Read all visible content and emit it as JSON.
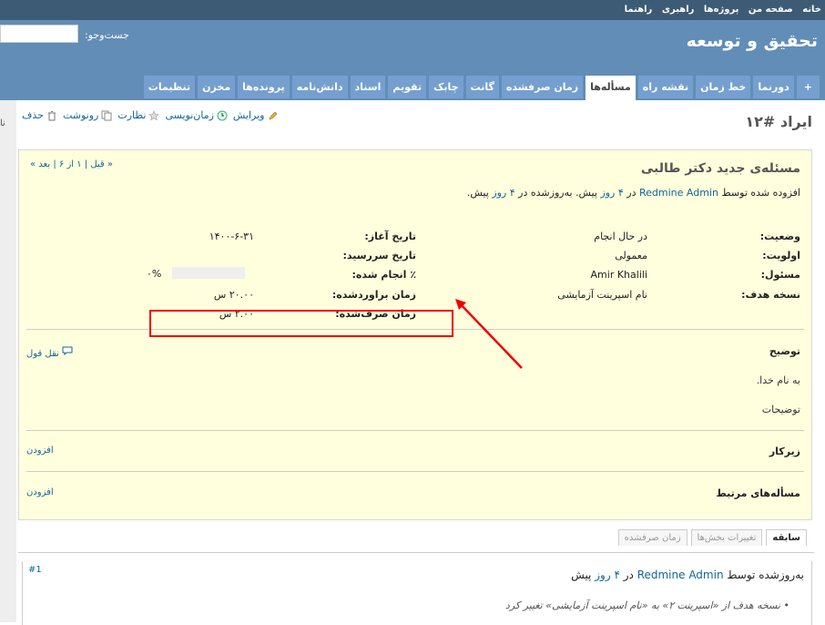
{
  "top_menu": [
    "خانه",
    "صفحه من",
    "پروژه‌ها",
    "راهبری",
    "راهنما"
  ],
  "header": {
    "title": "تحقیق و توسعه",
    "search_label": "جست‌وجو:",
    "search_value": ""
  },
  "tabs": [
    {
      "label": "+",
      "selected": false
    },
    {
      "label": "دورنما",
      "selected": false
    },
    {
      "label": "خط زمان",
      "selected": false
    },
    {
      "label": "نقشه راه",
      "selected": false
    },
    {
      "label": "مسأله‌ها",
      "selected": true
    },
    {
      "label": "زمان صرفشده",
      "selected": false
    },
    {
      "label": "گانت",
      "selected": false
    },
    {
      "label": "چابک",
      "selected": false
    },
    {
      "label": "تقویم",
      "selected": false
    },
    {
      "label": "اسناد",
      "selected": false
    },
    {
      "label": "دانش‌نامه",
      "selected": false
    },
    {
      "label": "پرونده‌ها",
      "selected": false
    },
    {
      "label": "مخزن",
      "selected": false
    },
    {
      "label": "تنظیمات",
      "selected": false
    }
  ],
  "sidebar_strip": "نا",
  "issue": {
    "title": "ایراد #۱۲",
    "actions": {
      "edit": "ویرایش",
      "log_time": "زمان‌نویسی",
      "watch": "نظارت",
      "copy": "رونوشت",
      "delete": "حذف"
    },
    "prevnext": "« قبل | ۱ از ۶ | بعد »",
    "subject": "مسئله‌ی جدید دکتر طالبی",
    "author_line": {
      "prefix": "افزوده شده توسط",
      "author": "Redmine Admin",
      "mid": "در",
      "added_ago": "۴ روز",
      "mid2": "پیش. به‌روزشده در",
      "updated_ago": "۴ روز",
      "suffix": "پیش."
    },
    "attributes": {
      "status_label": "وضعیت:",
      "status": "در حال انجام",
      "priority_label": "اولویت:",
      "priority": "معمولی",
      "assignee_label": "مسئول:",
      "assignee": "Amir Khalili",
      "version_label": "نسخه هدف:",
      "version": "نام اسپرینت آزمایشی",
      "start_label": "تاریخ آغاز:",
      "start": "۱۴۰۰-۶-۳۱",
      "due_label": "تاریخ سررسید:",
      "due": "",
      "done_label": "٪ انجام شده:",
      "done": "۰%",
      "done_ratio": 0,
      "estimated_label": "زمان براوردشده:",
      "estimated": "۲۰.۰۰ س",
      "spent_label": "زمان صرف‌شده:",
      "spent": "۲.۰۰ س"
    },
    "description": {
      "title": "توضیح",
      "quote": "نقل قول",
      "line1": "به نام خدا.",
      "line2": "توضیحات"
    },
    "subtasks": {
      "title": "زیرکار",
      "add": "افزودن"
    },
    "relations": {
      "title": "مسأله‌های مرتبط",
      "add": "افزودن"
    }
  },
  "history": {
    "tabs": [
      "سابقه",
      "تغییرات بخش‌ها",
      "زمان صرفشده"
    ],
    "journal": {
      "header_prefix": "به‌روزشده توسط",
      "author": "Redmine Admin",
      "mid": "در",
      "ago": "۴ روز",
      "suffix": "پیش",
      "number": "#1",
      "detail": "نسخه هدف از «اسپرینت ۲» به «نام اسپرینت آزمایشی» تغییر کرد"
    }
  }
}
